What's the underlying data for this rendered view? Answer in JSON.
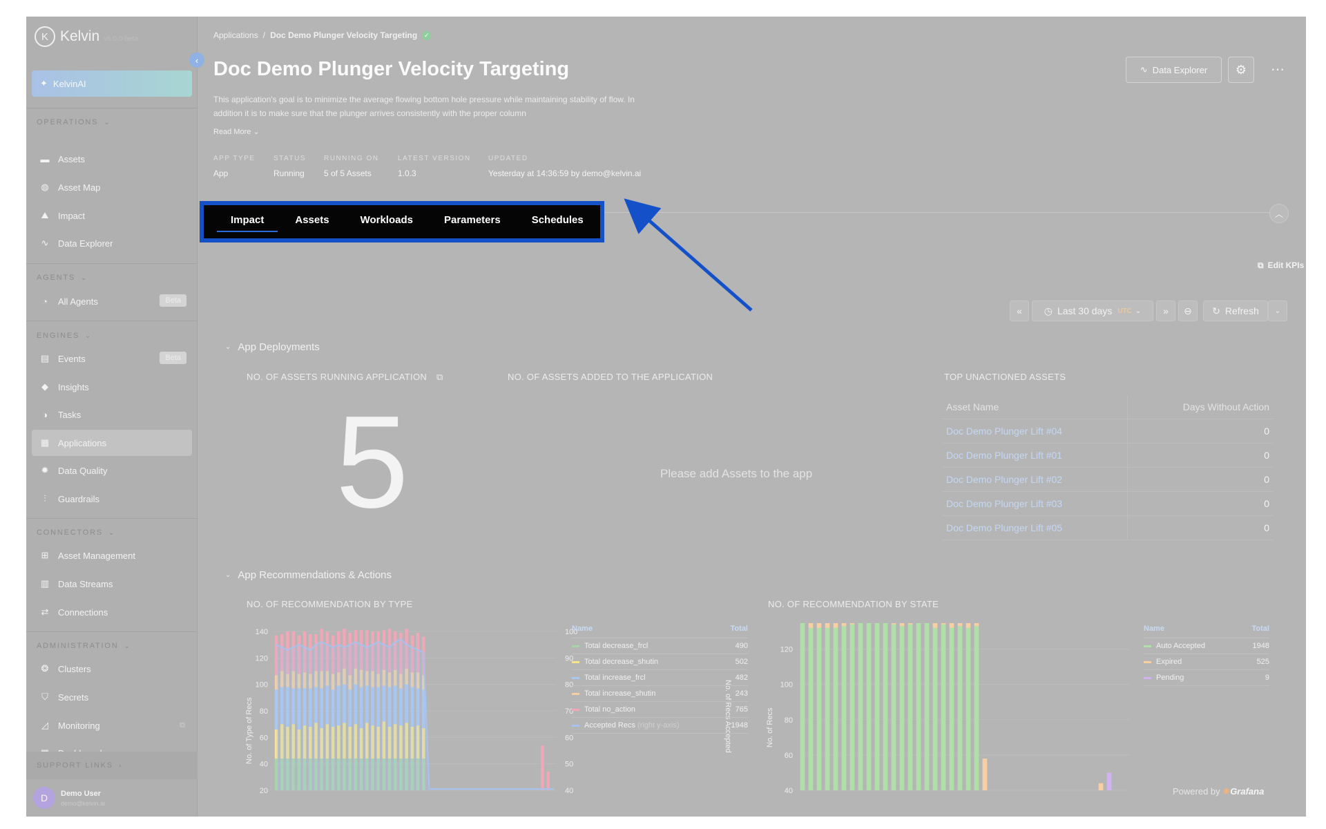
{
  "sidebar": {
    "brand": "Kelvin",
    "version": "v6.0.0-beta",
    "kelvinai": "KelvinAI",
    "sections": {
      "operations": "OPERATIONS",
      "agents": "AGENTS",
      "engines": "ENGINES",
      "connectors": "CONNECTORS",
      "administration": "ADMINISTRATION",
      "support": "SUPPORT LINKS"
    },
    "items": {
      "assets": "Assets",
      "asset_map": "Asset Map",
      "impact": "Impact",
      "data_explorer": "Data Explorer",
      "all_agents": "All Agents",
      "events": "Events",
      "insights": "Insights",
      "tasks": "Tasks",
      "applications": "Applications",
      "data_quality": "Data Quality",
      "guardrails": "Guardrails",
      "asset_management": "Asset Management",
      "data_streams": "Data Streams",
      "connections": "Connections",
      "clusters": "Clusters",
      "secrets": "Secrets",
      "monitoring": "Monitoring",
      "dashboard": "Dashboard"
    },
    "beta": "Beta",
    "user": {
      "initial": "D",
      "name": "Demo User",
      "email": "demo@kelvin.ai"
    }
  },
  "header": {
    "breadcrumb_root": "Applications",
    "breadcrumb_sep": "/",
    "breadcrumb_current": "Doc Demo Plunger Velocity Targeting",
    "title": "Doc Demo Plunger Velocity Targeting",
    "description": "This application's goal is to minimize the average flowing bottom hole pressure while maintaining stability of flow. In addition it is to make sure that the plunger arrives consistently with the proper column",
    "read_more": "Read More",
    "data_explorer_btn": "Data Explorer",
    "meta": [
      {
        "key": "APP TYPE",
        "value": "App"
      },
      {
        "key": "STATUS",
        "value": "Running"
      },
      {
        "key": "RUNNING ON",
        "value": "5 of 5 Assets"
      },
      {
        "key": "LATEST VERSION",
        "value": "1.0.3"
      },
      {
        "key": "UPDATED",
        "value": "Yesterday at 14:36:59 by demo@kelvin.ai"
      }
    ]
  },
  "tabs": [
    "Impact",
    "Assets",
    "Workloads",
    "Parameters",
    "Schedules"
  ],
  "toolbar": {
    "edit_kpis": "Edit KPIs",
    "time_range": "Last 30 days",
    "tz": "UTC",
    "refresh": "Refresh"
  },
  "deployments": {
    "row_title": "App Deployments",
    "running_title": "NO. OF ASSETS RUNNING APPLICATION",
    "running_value": "5",
    "added_title": "NO. OF ASSETS ADDED TO THE APPLICATION",
    "added_empty": "Please add Assets to the app",
    "unactioned_title": "TOP UNACTIONED ASSETS",
    "unactioned_cols": [
      "Asset Name",
      "Days Without Action"
    ],
    "unactioned_rows": [
      [
        "Doc Demo Plunger Lift #04",
        "0"
      ],
      [
        "Doc Demo Plunger Lift #01",
        "0"
      ],
      [
        "Doc Demo Plunger Lift #02",
        "0"
      ],
      [
        "Doc Demo Plunger Lift #03",
        "0"
      ],
      [
        "Doc Demo Plunger Lift #05",
        "0"
      ]
    ]
  },
  "recs": {
    "row_title": "App Recommendations & Actions",
    "by_type_title": "NO. OF RECOMMENDATION BY TYPE",
    "by_state_title": "NO. OF RECOMMENDATION BY STATE",
    "legend_name": "Name",
    "legend_total": "Total",
    "type_ylabel": "No. of Type of Recs",
    "type_y2label": "No. of Recs Accepted",
    "state_ylabel": "No. of Recs",
    "type_legend": [
      {
        "name": "Total decrease_frcl",
        "total": "490",
        "color": "#a8d4a8"
      },
      {
        "name": "Total decrease_shutin",
        "total": "502",
        "color": "#f4e58e"
      },
      {
        "name": "Total increase_frcl",
        "total": "482",
        "color": "#a8c8f0"
      },
      {
        "name": "Total increase_shutin",
        "total": "243",
        "color": "#f3d0a3"
      },
      {
        "name": "Total no_action",
        "total": "765",
        "color": "#f0a7b7"
      },
      {
        "name": "Accepted Recs",
        "suffix": "(right y-axis)",
        "total": "1948",
        "color": "#a8c2ee"
      }
    ],
    "state_legend": [
      {
        "name": "Auto Accepted",
        "total": "1948",
        "color": "#aee0a8"
      },
      {
        "name": "Expired",
        "total": "525",
        "color": "#f6d0a2"
      },
      {
        "name": "Pending",
        "total": "9",
        "color": "#d2b3f0"
      }
    ],
    "powered_by": "Powered by",
    "powered_brand": "Grafana"
  },
  "chart_data": [
    {
      "type": "bar",
      "title": "NO. OF RECOMMENDATION BY TYPE",
      "ylabel": "No. of Type of Recs",
      "y2label": "No. of Recs Accepted",
      "ylim": [
        20,
        140
      ],
      "y2lim": [
        40,
        100
      ],
      "y_ticks": [
        20,
        40,
        60,
        80,
        100,
        120,
        140
      ],
      "y2_ticks": [
        40,
        50,
        60,
        70,
        80,
        90,
        100
      ],
      "stacked": true,
      "series": [
        {
          "name": "Total decrease_frcl",
          "values": [
            24,
            24,
            24,
            24,
            24,
            24,
            24,
            24,
            24,
            24,
            24,
            24,
            24,
            24,
            24,
            24,
            24,
            24,
            24,
            24,
            24,
            24,
            24,
            24,
            24,
            24,
            24,
            0,
            0,
            0,
            0,
            0,
            0,
            0,
            0,
            0,
            0,
            0,
            0,
            0,
            0,
            0,
            0,
            0,
            0,
            0,
            0,
            0,
            0,
            0
          ]
        },
        {
          "name": "Total decrease_shutin",
          "values": [
            22,
            26,
            24,
            26,
            22,
            25,
            24,
            27,
            23,
            26,
            24,
            25,
            27,
            24,
            26,
            23,
            27,
            25,
            24,
            28,
            24,
            26,
            25,
            27,
            24,
            25,
            23,
            0,
            0,
            0,
            0,
            0,
            0,
            0,
            0,
            0,
            0,
            0,
            0,
            0,
            0,
            0,
            0,
            0,
            0,
            0,
            0,
            0,
            0,
            0
          ]
        },
        {
          "name": "Total increase_frcl",
          "values": [
            30,
            28,
            30,
            27,
            31,
            28,
            29,
            27,
            30,
            29,
            28,
            30,
            29,
            28,
            30,
            31,
            28,
            29,
            30,
            27,
            30,
            29,
            28,
            29,
            30,
            28,
            29,
            0,
            0,
            0,
            0,
            0,
            0,
            0,
            0,
            0,
            0,
            0,
            0,
            0,
            0,
            0,
            0,
            0,
            0,
            0,
            0,
            0,
            0,
            0
          ]
        },
        {
          "name": "Total increase_shutin",
          "values": [
            11,
            12,
            10,
            13,
            11,
            12,
            11,
            12,
            13,
            11,
            12,
            10,
            12,
            11,
            12,
            13,
            11,
            12,
            10,
            12,
            11,
            12,
            11,
            12,
            11,
            12,
            11,
            0,
            0,
            0,
            0,
            0,
            0,
            0,
            0,
            0,
            0,
            0,
            0,
            0,
            0,
            0,
            0,
            0,
            0,
            0,
            0,
            0,
            0,
            0
          ]
        },
        {
          "name": "Total no_action",
          "values": [
            30,
            28,
            32,
            30,
            29,
            31,
            30,
            28,
            32,
            30,
            29,
            31,
            30,
            32,
            29,
            30,
            31,
            30,
            32,
            30,
            33,
            29,
            31,
            30,
            28,
            30,
            29,
            0,
            0,
            0,
            0,
            0,
            0,
            0,
            0,
            0,
            0,
            0,
            0,
            0,
            0,
            0,
            0,
            0,
            0,
            0,
            0,
            0,
            0,
            0
          ]
        },
        {
          "name": "Accepted Recs",
          "axis": "right",
          "values": [
            95,
            94,
            93,
            94,
            95,
            94,
            93,
            95,
            96,
            95,
            94,
            95,
            94,
            95,
            96,
            95,
            94,
            95,
            96,
            95,
            94,
            96,
            97,
            95,
            94,
            93,
            92,
            18,
            17,
            16,
            15,
            14,
            13,
            12,
            11,
            10,
            10,
            10,
            10,
            10,
            10,
            10,
            10,
            10,
            10,
            10,
            10,
            10,
            10,
            10
          ]
        }
      ],
      "late_bars": [
        {
          "index": 47,
          "stack": [
            0,
            0,
            0,
            0,
            34,
            0
          ]
        },
        {
          "index": 48,
          "stack": [
            0,
            0,
            0,
            0,
            14,
            0
          ]
        }
      ]
    },
    {
      "type": "bar",
      "title": "NO. OF RECOMMENDATION BY STATE",
      "ylabel": "No. of Recs",
      "ylim": [
        40,
        130
      ],
      "y_ticks": [
        40,
        60,
        80,
        100,
        120
      ],
      "stacked": true,
      "series": [
        {
          "name": "Auto Accepted",
          "values": [
            96,
            92,
            92,
            92,
            92,
            93,
            94,
            95,
            96,
            96,
            95,
            94,
            93,
            94,
            95,
            96,
            92,
            94,
            92,
            93,
            92,
            93,
            0,
            0,
            0,
            0,
            0,
            0,
            0,
            0,
            0,
            0,
            0,
            0,
            0,
            0,
            0,
            0,
            0,
            0
          ]
        },
        {
          "name": "Expired",
          "values": [
            29,
            22,
            23,
            23,
            24,
            26,
            25,
            30,
            29,
            30,
            31,
            31,
            29,
            27,
            30,
            30,
            24,
            27,
            23,
            26,
            23,
            26,
            18,
            0,
            0,
            0,
            0,
            0,
            0,
            0,
            0,
            0,
            0,
            0,
            0,
            0,
            0,
            0,
            0,
            0
          ]
        },
        {
          "name": "Pending",
          "values": [
            0,
            0,
            0,
            0,
            0,
            0,
            0,
            0,
            0,
            0,
            0,
            0,
            0,
            0,
            0,
            0,
            0,
            0,
            0,
            0,
            0,
            0,
            0,
            0,
            0,
            0,
            0,
            0,
            0,
            0,
            0,
            0,
            0,
            0,
            0,
            0,
            0,
            0,
            0,
            0
          ]
        }
      ],
      "late_bars": [
        {
          "index": 36,
          "stack": [
            0,
            4,
            0
          ]
        },
        {
          "index": 37,
          "stack": [
            0,
            0,
            10
          ]
        }
      ]
    }
  ]
}
